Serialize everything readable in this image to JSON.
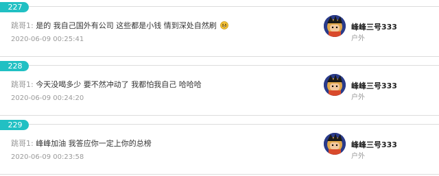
{
  "comments": [
    {
      "floor": "227",
      "speaker": "跳哥1:",
      "message": "是的 我自己国外有公司 这些都是小钱 情到深处自然刷",
      "time": "2020-06-09 00:25:41",
      "user": {
        "name": "峰峰三号333",
        "location": "户外"
      }
    },
    {
      "floor": "228",
      "speaker": "跳哥1:",
      "message": "今天没喝多少 要不然冲动了 我都怕我自己 哈哈哈",
      "time": "2020-06-09 00:24:20",
      "user": {
        "name": "峰峰三号333",
        "location": "户外"
      }
    },
    {
      "floor": "229",
      "speaker": "跳哥1:",
      "message": "峰峰加油 我答应你一定上你的总榜",
      "time": "2020-06-09 00:23:58",
      "user": {
        "name": "峰峰三号333",
        "location": "户外"
      }
    }
  ],
  "colors": {
    "badge": "#21c0c3",
    "muted": "#9a9a9a",
    "text": "#333333"
  }
}
